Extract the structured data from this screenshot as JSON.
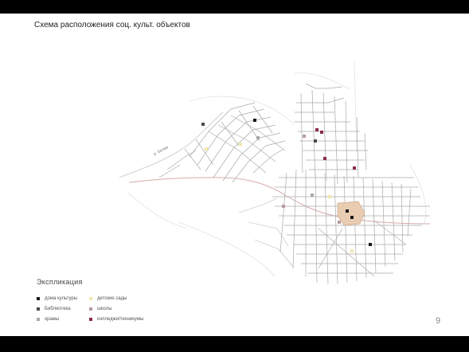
{
  "title": "Схема расположения соц. культ. объектов",
  "river_label": "р. Белая",
  "legend": {
    "heading": "Экспликация",
    "items": [
      {
        "label": "дома культуры",
        "color": "#1a1a1a"
      },
      {
        "label": "детские сады",
        "color": "#f3e7ad"
      },
      {
        "label": "Библиотека",
        "color": "#4c4c4c"
      },
      {
        "label": "школы",
        "color": "#b79aa2"
      },
      {
        "label": "храмы",
        "color": "#a9a9a9"
      },
      {
        "label": "колледжи/техникумы",
        "color": "#8b2c46"
      }
    ]
  },
  "page_number": "9"
}
